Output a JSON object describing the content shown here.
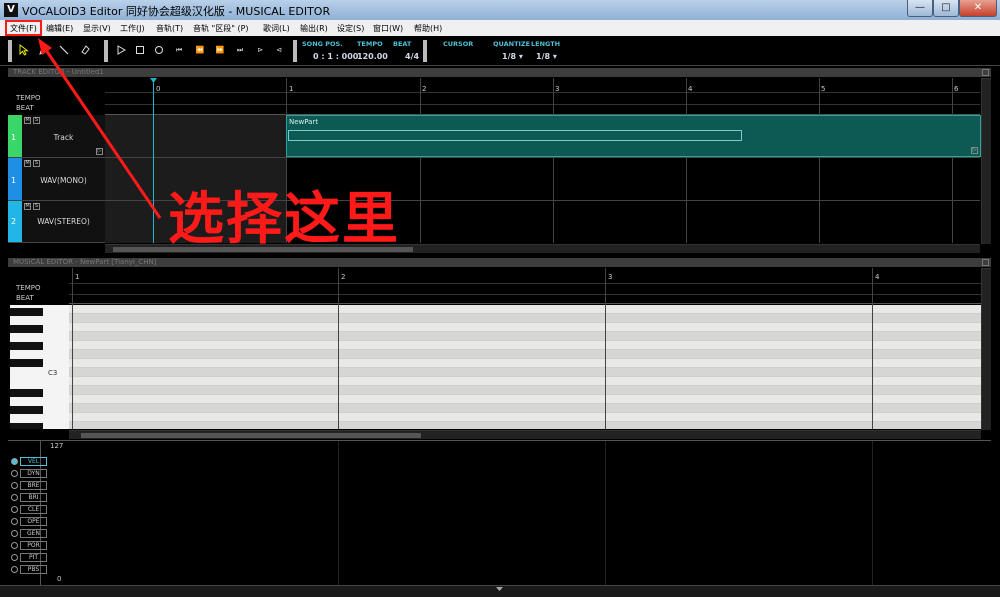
{
  "window": {
    "app_icon": "V",
    "title": "VOCALOID3 Editor 同好协会超级汉化版 - MUSICAL EDITOR",
    "min": "—",
    "max": "□",
    "close": "✕"
  },
  "menu": [
    "文件(F)",
    "编辑(E)",
    "显示(V)",
    "工作(J)",
    "音轨(T)",
    "音轨 \"区段\" (P)",
    "歌词(L)",
    "输出(R)",
    "设定(S)",
    "窗口(W)",
    "帮助(H)"
  ],
  "toolbar": {
    "tools": [
      "pointer-icon",
      "pencil-icon",
      "line-icon",
      "eraser-icon"
    ],
    "transport": [
      "play-icon",
      "stop-icon",
      "record-icon",
      "rewind-start-icon",
      "rewind-icon",
      "fast-forward-icon",
      "forward-end-icon",
      "loop-start-icon",
      "loop-end-icon"
    ],
    "song_pos_label": "SONG POS.",
    "song_pos": "0 : 1 : 000",
    "tempo_label": "TEMPO",
    "tempo": "120.00",
    "beat_label": "BEAT",
    "beat": "4/4",
    "cursor_label": "CURSOR",
    "quantize_label": "QUANTIZE",
    "quantize": "1/8 ▾",
    "length_label": "LENGTH",
    "length": "1/8 ▾"
  },
  "track_editor": {
    "title": "TRACK EDITOR - Untitled1",
    "tempo_label": "TEMPO",
    "beat_label": "BEAT",
    "ruler": [
      "0",
      "1",
      "2",
      "3",
      "4",
      "5",
      "6"
    ],
    "tracks": [
      {
        "num": "1",
        "name": "Track",
        "color": "#3ad66a"
      },
      {
        "num": "1",
        "name": "WAV(MONO)",
        "color": "#1f8fe6"
      },
      {
        "num": "2",
        "name": "WAV(STEREO)",
        "color": "#22b6e6"
      }
    ],
    "part_name": "NewPart",
    "m": "M",
    "s": "S"
  },
  "musical_editor": {
    "title": "MUSICAL EDITOR - NewPart [Tianyi_CHN]",
    "tempo_label": "TEMPO",
    "beat_label": "BEAT",
    "ruler": [
      "1",
      "2",
      "3",
      "4"
    ],
    "note_label": "C3",
    "vel_max": "127",
    "vel_min": "0",
    "controls": [
      "VEL",
      "DYN",
      "BRE",
      "BRI",
      "CLE",
      "OPE",
      "GEN",
      "POR",
      "PIT",
      "PBS"
    ]
  },
  "annotation": {
    "text": "选择这里",
    "color": "#ff1a1a"
  }
}
